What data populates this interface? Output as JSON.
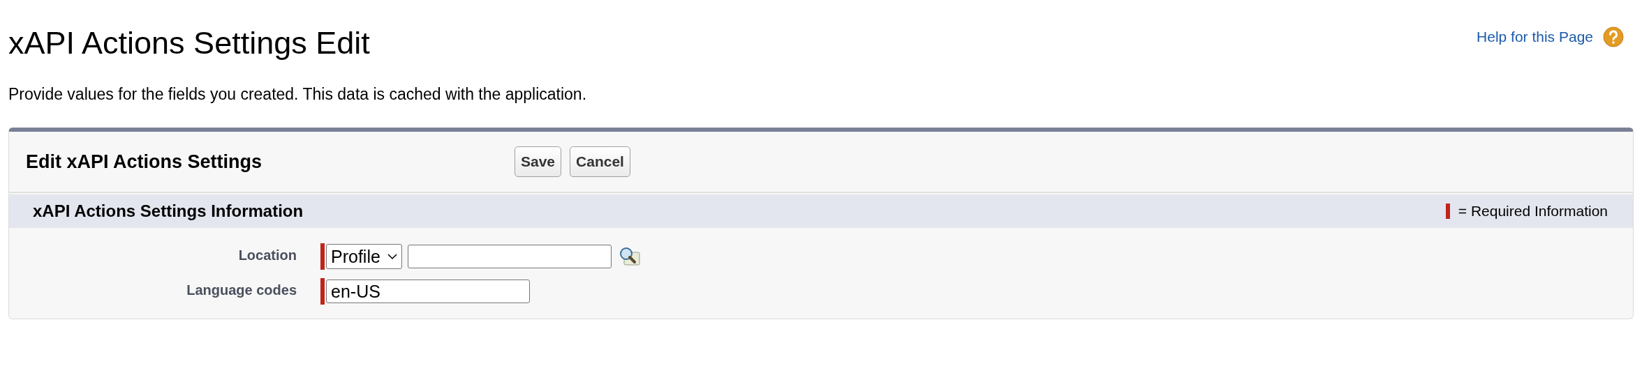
{
  "page": {
    "title": "xAPI Actions Settings Edit",
    "help_link": "Help for this Page",
    "description": "Provide values for the fields you created. This data is cached with the application."
  },
  "panel": {
    "title": "Edit xAPI Actions Settings",
    "buttons": [
      "Save",
      "Cancel"
    ],
    "section": {
      "title": "xAPI Actions Settings Information",
      "legend": "= Required Information"
    },
    "fields": [
      {
        "kind": "lookup",
        "label": "Location",
        "required": true,
        "select": "Profile"
      },
      {
        "kind": "text",
        "label": "Language codes",
        "required": true,
        "value": "en-US"
      }
    ]
  }
}
